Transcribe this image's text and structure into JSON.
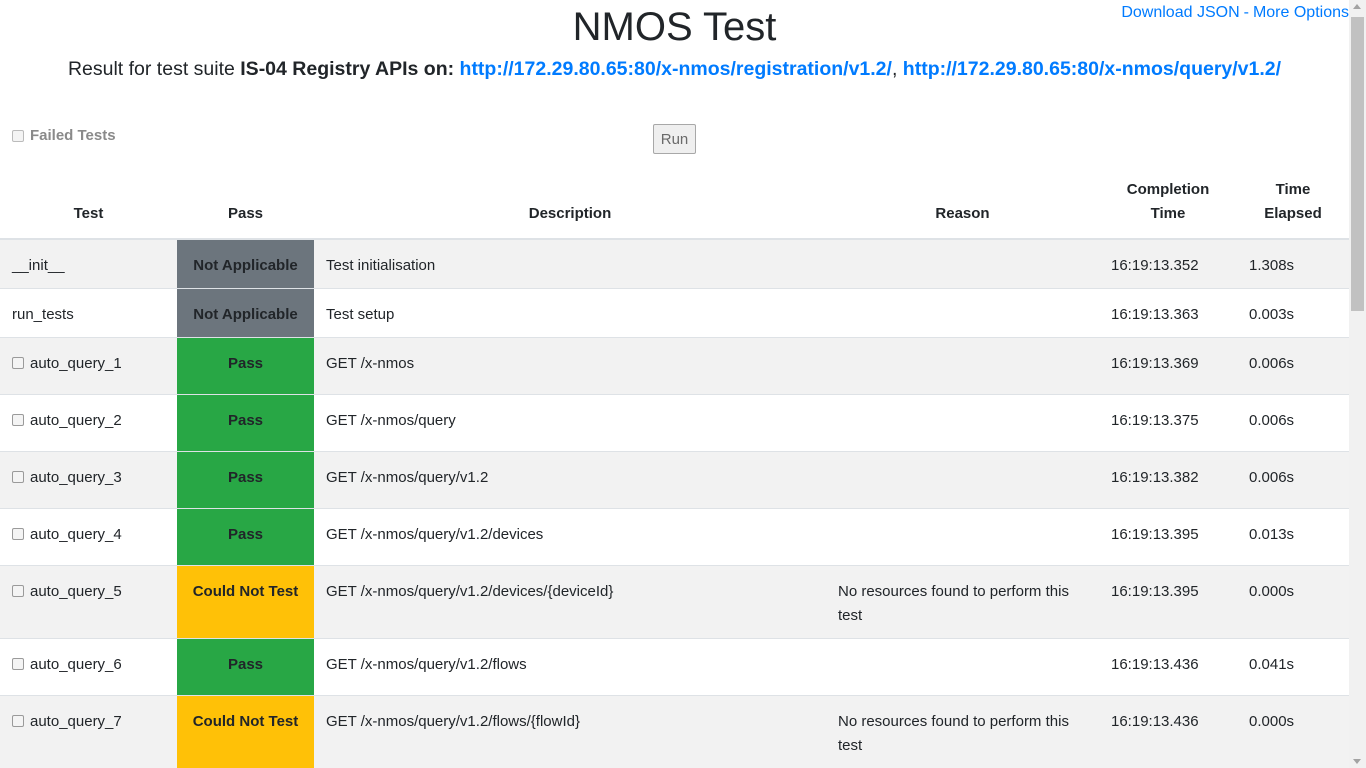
{
  "header": {
    "download_json": "Download JSON",
    "separator": "-",
    "more_options": "More Options",
    "title": "NMOS Test",
    "subtitle_prefix": "Result for test suite ",
    "suite_name": "IS-04 Registry APIs",
    "subtitle_on": " on: ",
    "url_registration": "http://172.29.80.65:80/x-nmos/registration/v1.2/",
    "url_comma": ", ",
    "url_query": "http://172.29.80.65:80/x-nmos/query/v1.2/"
  },
  "filter": {
    "failed_tests_label": "Failed Tests",
    "checked": false
  },
  "run_button": {
    "label": "Run"
  },
  "table": {
    "headers": {
      "test": "Test",
      "pass": "Pass",
      "description": "Description",
      "reason": "Reason",
      "completion_1": "Completion",
      "completion_2": "Time",
      "elapsed_1": "Time",
      "elapsed_2": "Elapsed"
    },
    "rows": [
      {
        "test": "__init__",
        "checkbox": false,
        "status": "Not Applicable",
        "description": "Test initialisation",
        "reason": "",
        "completion": "16:19:13.352",
        "elapsed": "1.308s"
      },
      {
        "test": "run_tests",
        "checkbox": false,
        "status": "Not Applicable",
        "description": "Test setup",
        "reason": "",
        "completion": "16:19:13.363",
        "elapsed": "0.003s"
      },
      {
        "test": "auto_query_1",
        "checkbox": true,
        "status": "Pass",
        "description": "GET /x-nmos",
        "reason": "",
        "completion": "16:19:13.369",
        "elapsed": "0.006s"
      },
      {
        "test": "auto_query_2",
        "checkbox": true,
        "status": "Pass",
        "description": "GET /x-nmos/query",
        "reason": "",
        "completion": "16:19:13.375",
        "elapsed": "0.006s"
      },
      {
        "test": "auto_query_3",
        "checkbox": true,
        "status": "Pass",
        "description": "GET /x-nmos/query/v1.2",
        "reason": "",
        "completion": "16:19:13.382",
        "elapsed": "0.006s"
      },
      {
        "test": "auto_query_4",
        "checkbox": true,
        "status": "Pass",
        "description": "GET /x-nmos/query/v1.2/devices",
        "reason": "",
        "completion": "16:19:13.395",
        "elapsed": "0.013s"
      },
      {
        "test": "auto_query_5",
        "checkbox": true,
        "status": "Could Not Test",
        "description": "GET /x-nmos/query/v1.2/devices/{deviceId}",
        "reason": "No resources found to perform this test",
        "completion": "16:19:13.395",
        "elapsed": "0.000s"
      },
      {
        "test": "auto_query_6",
        "checkbox": true,
        "status": "Pass",
        "description": "GET /x-nmos/query/v1.2/flows",
        "reason": "",
        "completion": "16:19:13.436",
        "elapsed": "0.041s"
      },
      {
        "test": "auto_query_7",
        "checkbox": true,
        "status": "Could Not Test",
        "description": "GET /x-nmos/query/v1.2/flows/{flowId}",
        "reason": "No resources found to perform this test",
        "completion": "16:19:13.436",
        "elapsed": "0.000s"
      }
    ]
  },
  "colors": {
    "link": "#007bff",
    "not_applicable": "#6c757d",
    "pass": "#28a745",
    "could_not_test": "#ffc107"
  }
}
